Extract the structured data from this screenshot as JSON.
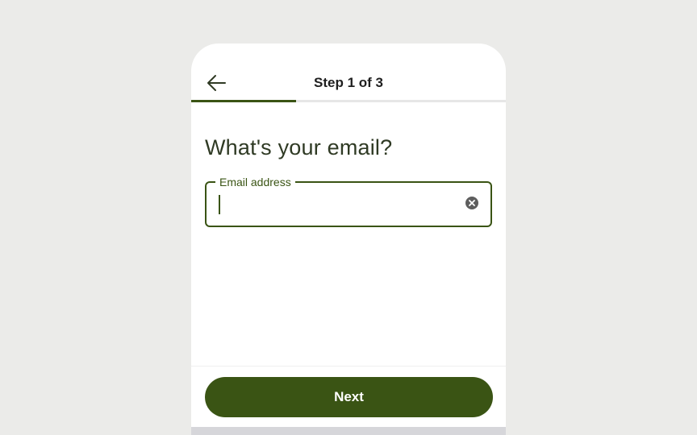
{
  "header": {
    "back_icon": "arrow-left-icon",
    "step_title": "Step 1 of 3",
    "progress_fraction": 0.333
  },
  "main": {
    "question": "What's your email?",
    "email_field": {
      "label": "Email address",
      "value": "",
      "placeholder": "",
      "clear_icon": "clear-circle-icon"
    }
  },
  "footer": {
    "next_label": "Next"
  },
  "colors": {
    "accent": "#3a5414",
    "background": "#ebebe9",
    "card": "#ffffff"
  }
}
